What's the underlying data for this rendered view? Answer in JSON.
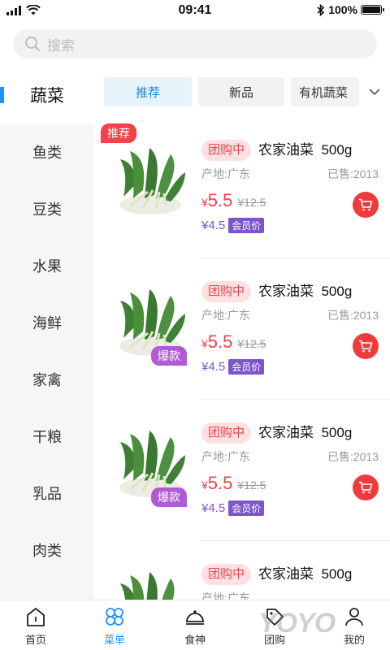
{
  "status_bar": {
    "time": "09:41",
    "battery": "100%"
  },
  "search": {
    "placeholder": "搜索"
  },
  "sidebar": {
    "items": [
      {
        "label": "蔬菜",
        "active": true
      },
      {
        "label": "鱼类"
      },
      {
        "label": "豆类"
      },
      {
        "label": "水果"
      },
      {
        "label": "海鲜"
      },
      {
        "label": "家禽"
      },
      {
        "label": "干粮"
      },
      {
        "label": "乳品"
      },
      {
        "label": "肉类"
      }
    ]
  },
  "tabs": [
    {
      "label": "推荐",
      "active": true
    },
    {
      "label": "新品"
    },
    {
      "label": "有机蔬菜"
    }
  ],
  "products": [
    {
      "badge": "推荐",
      "group_tag": "团购中",
      "name": "农家油菜",
      "weight": "500g",
      "origin": "产地:广东",
      "sold": "已售:2013",
      "currency": "¥",
      "price": "5.5",
      "old_price": "¥12.5",
      "member_price": "¥4.5",
      "member_tag": "会员价"
    },
    {
      "badge": "爆款",
      "group_tag": "团购中",
      "name": "农家油菜",
      "weight": "500g",
      "origin": "产地:广东",
      "sold": "已售:2013",
      "currency": "¥",
      "price": "5.5",
      "old_price": "¥12.5",
      "member_price": "¥4.5",
      "member_tag": "会员价"
    },
    {
      "badge": "爆款",
      "group_tag": "团购中",
      "name": "农家油菜",
      "weight": "500g",
      "origin": "产地:广东",
      "sold": "已售:2013",
      "currency": "¥",
      "price": "5.5",
      "old_price": "¥12.5",
      "member_price": "¥4.5",
      "member_tag": "会员价"
    },
    {
      "badge": "",
      "group_tag": "团购中",
      "name": "农家油菜",
      "weight": "500g",
      "origin": "产地:广东",
      "sold": "",
      "currency": "",
      "price": "",
      "old_price": "",
      "member_price": "",
      "member_tag": ""
    }
  ],
  "bottom_nav": [
    {
      "label": "首页",
      "icon": "home-icon"
    },
    {
      "label": "菜单",
      "icon": "menu-grid-icon",
      "active": true
    },
    {
      "label": "食神",
      "icon": "chef-hat-icon"
    },
    {
      "label": "团购",
      "icon": "tag-icon"
    },
    {
      "label": "我的",
      "icon": "user-icon"
    }
  ],
  "watermark": "YOYO",
  "colors": {
    "accent": "#1e90ff",
    "price": "#f0424a",
    "member": "#7b55c9"
  }
}
